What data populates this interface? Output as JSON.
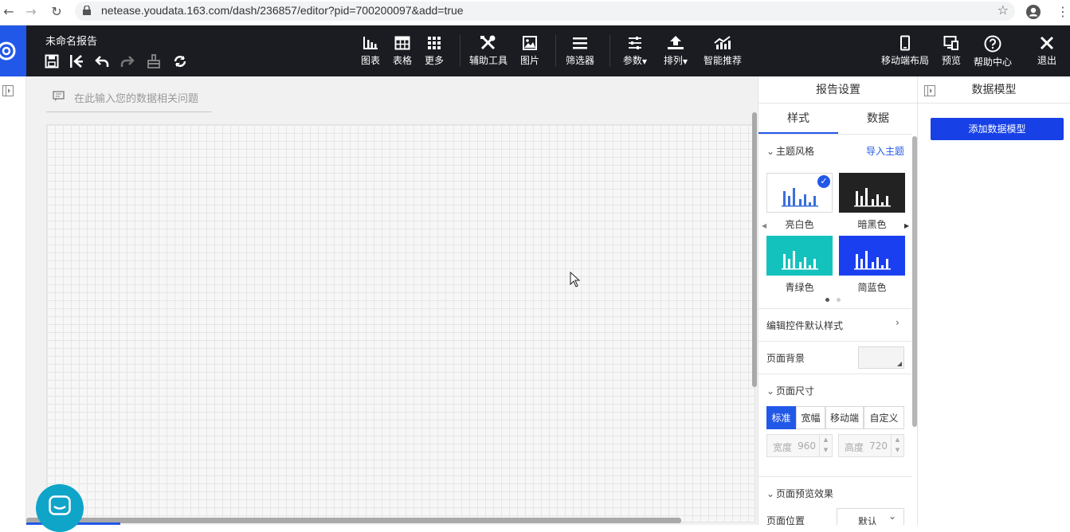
{
  "browser": {
    "url": "netease.youdata.163.com/dash/236857/editor?pid=700200097&add=true"
  },
  "toolbar": {
    "doc_title": "未命名报告",
    "items": {
      "chart": "图表",
      "table": "表格",
      "more": "更多",
      "aux_tools": "辅助工具",
      "image": "图片",
      "filter": "筛选器",
      "params": "参数",
      "arrange": "排列",
      "smart": "智能推荐",
      "mobile_layout": "移动端布局",
      "preview": "预览",
      "help": "帮助中心",
      "exit": "退出"
    }
  },
  "canvas": {
    "ask_placeholder": "在此输入您的数据相关问题"
  },
  "settings": {
    "title": "报告设置",
    "tabs": [
      "样式",
      "数据"
    ],
    "theme_section": "主题风格",
    "import_theme": "导入主题",
    "themes": [
      {
        "label": "亮白色",
        "bg": "#ffffff",
        "bars": "#3a6fd8",
        "selected": true
      },
      {
        "label": "暗黑色",
        "bg": "#222222",
        "bars": "#ffffff",
        "selected": false
      },
      {
        "label": "青绿色",
        "bg": "#14c2bd",
        "bars": "#ffffff",
        "selected": false
      },
      {
        "label": "简蓝色",
        "bg": "#1a3ff0",
        "bars": "#ffffff",
        "selected": false
      }
    ],
    "edit_default_style": "编辑控件默认样式",
    "page_background": "页面背景",
    "page_size_section": "页面尺寸",
    "size_options": [
      "标准",
      "宽幅",
      "移动端",
      "自定义"
    ],
    "width_label": "宽度",
    "width_value": "960",
    "height_label": "高度",
    "height_value": "720",
    "preview_section": "页面预览效果",
    "page_position_label": "页面位置",
    "page_position_value": "默认"
  },
  "datamodel": {
    "title": "数据模型",
    "add_button": "添加数据模型"
  },
  "colors": {
    "accent": "#2258e8",
    "toolbar_bg": "#1b1c22",
    "chat_button": "#0fa5c9"
  }
}
